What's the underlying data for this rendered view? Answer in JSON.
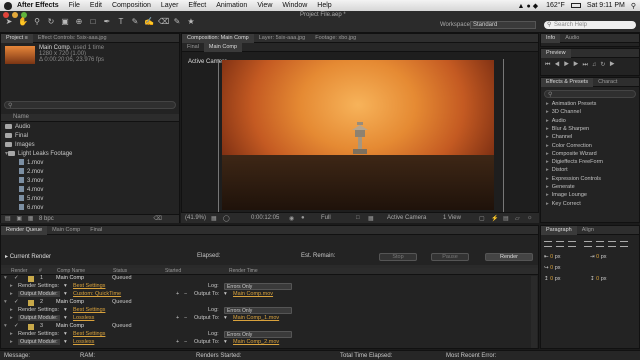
{
  "menubar": {
    "app": "After Effects",
    "items": [
      "File",
      "Edit",
      "Composition",
      "Layer",
      "Effect",
      "Animation",
      "View",
      "Window",
      "Help"
    ],
    "temp": "162°F",
    "clock": "Sat 9:11 PM"
  },
  "window": {
    "title": "Project File.aep *"
  },
  "workspace": {
    "label": "Workspace:",
    "value": "Standard"
  },
  "search_help": {
    "placeholder": "Search Help"
  },
  "project": {
    "tab": "Project ≡",
    "tab2": "Effect Controls: 5six-aaa.jpg",
    "comp_name": "Main Comp",
    "used": ", used 1 time",
    "dims": "1280 x 720 (1.00)",
    "duration": "Δ 0:00:20:06, 23.976 fps",
    "name_header": "Name",
    "items": [
      "Audio",
      "Final",
      "Images",
      "Light Leaks Footage",
      "1.mov",
      "2.mov",
      "3.mov",
      "4.mov",
      "5.mov",
      "6.mov"
    ],
    "bpc": "8 bpc"
  },
  "viewer": {
    "tabs": [
      "Composition: Main Comp",
      "Layer: 5six-aaa.jpg",
      "Footage: xbo.jpg"
    ],
    "subtabs": [
      "Final",
      "Main Comp"
    ],
    "active_camera": "Active Camera",
    "zoom": "(41.9%)",
    "timecode": "0:00:12:05",
    "resolution": "Full",
    "camera": "Active Camera",
    "view": "1 View"
  },
  "info": {
    "tabs": [
      "Info",
      "Audio"
    ]
  },
  "preview": {
    "tab": "Preview"
  },
  "effects": {
    "tabs": [
      "Effects & Presets",
      "Charact"
    ],
    "items": [
      "Animation Presets",
      "3D Channel",
      "Audio",
      "Blur & Sharpen",
      "Channel",
      "Color Correction",
      "Composite Wizard",
      "Digieffects FreeForm",
      "Distort",
      "Expression Controls",
      "Generate",
      "Image Lounge",
      "Key Correct"
    ]
  },
  "paragraph": {
    "tabs": [
      "Paragraph",
      "Align"
    ],
    "fields": [
      "px",
      "px",
      "px",
      "px",
      "px"
    ]
  },
  "render_queue": {
    "tabs": [
      "Render Queue",
      "Main Comp",
      "Final"
    ],
    "current_render": "Current Render",
    "elapsed": "Elapsed:",
    "est_remain": "Est. Remain:",
    "stop": "Stop",
    "pause": "Pause",
    "render": "Render",
    "columns": [
      "Render",
      "#",
      "Comp Name",
      "Status",
      "Started",
      "Render Time"
    ],
    "items": [
      {
        "num": "1",
        "comp": "Main Comp",
        "status": "Queued",
        "settings_label": "Render Settings:",
        "settings": "Best Settings",
        "log_label": "Log:",
        "log": "Errors Only",
        "output_label": "Output Module:",
        "output": "Custom: QuickTime",
        "output_to_label": "Output To:",
        "output_to": "Main Comp.mov"
      },
      {
        "num": "2",
        "comp": "Main Comp",
        "status": "Queued",
        "settings_label": "Render Settings:",
        "settings": "Best Settings",
        "log_label": "Log:",
        "log": "Errors Only",
        "output_label": "Output Module:",
        "output": "Lossless",
        "output_to_label": "Output To:",
        "output_to": "Main Comp_1.mov"
      },
      {
        "num": "3",
        "comp": "Main Comp",
        "status": "Queued",
        "settings_label": "Render Settings:",
        "settings": "Best Settings",
        "log_label": "Log:",
        "log": "Errors Only",
        "output_label": "Output Module:",
        "output": "Lossless",
        "output_to_label": "Output To:",
        "output_to": "Main Comp_2.mov"
      }
    ]
  },
  "statusbar": {
    "message": "Message:",
    "ram": "RAM:",
    "renders_started": "Renders Started:",
    "total_time": "Total Time Elapsed:",
    "recent_error": "Most Recent Error:"
  },
  "colors": {
    "accent": "#d9a23c",
    "link": "#d9a23c",
    "bg": "#232323"
  }
}
